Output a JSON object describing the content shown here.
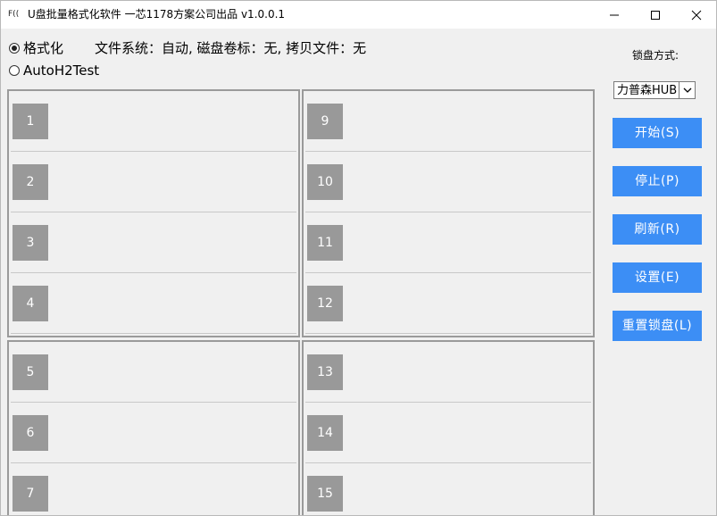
{
  "window": {
    "icon_text": "F((",
    "title": "U盘批量格式化软件  一芯1178方案公司出品 v1.0.0.1",
    "controls": [
      "minimize-icon",
      "maximize-icon",
      "close-icon"
    ]
  },
  "options": {
    "format_label": "格式化",
    "format_checked": true,
    "auto_label": "AutoH2Test",
    "auto_checked": false,
    "info": "文件系统：自动, 磁盘卷标：无, 拷贝文件：无"
  },
  "lock": {
    "label": "锁盘方式:",
    "selected": "力普森HUB"
  },
  "buttons": {
    "start": "开始(S)",
    "stop": "停止(P)",
    "refresh": "刷新(R)",
    "settings": "设置(E)",
    "reset_lock": "重置锁盘(L)"
  },
  "ports": {
    "g1": [
      "1",
      "2",
      "3",
      "4"
    ],
    "g2": [
      "9",
      "10",
      "11",
      "12"
    ],
    "g3": [
      "5",
      "6",
      "7"
    ],
    "g4": [
      "13",
      "14",
      "15"
    ]
  },
  "colors": {
    "button_bg": "#3c8ef5",
    "slot_number_bg": "#999999",
    "group_border": "#9a9a9a"
  }
}
